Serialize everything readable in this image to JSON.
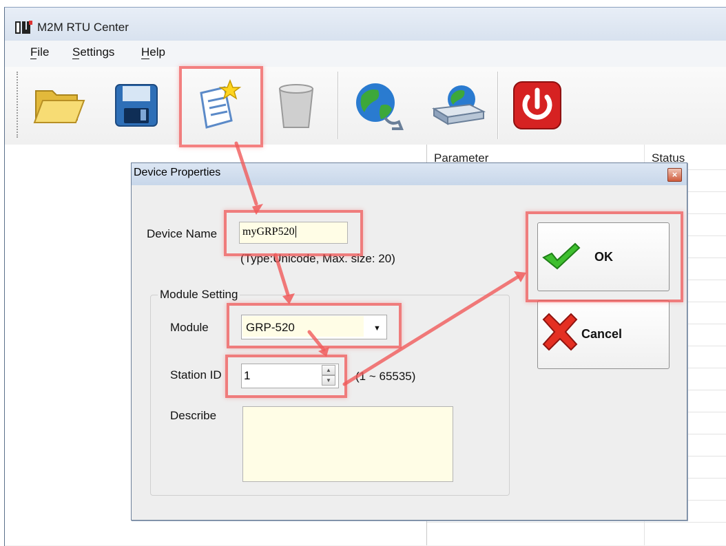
{
  "window": {
    "title": "M2M RTU Center"
  },
  "menu": {
    "items": [
      {
        "label": "File"
      },
      {
        "label": "Settings"
      },
      {
        "label": "Help"
      }
    ]
  },
  "toolbar": {
    "buttons": [
      {
        "icon": "open-folder-icon"
      },
      {
        "icon": "save-disk-icon"
      },
      {
        "icon": "new-document-star-icon"
      },
      {
        "icon": "trash-can-icon"
      },
      {
        "icon": "globe-connect-icon"
      },
      {
        "icon": "globe-server-icon"
      },
      {
        "icon": "power-icon"
      }
    ]
  },
  "grid": {
    "columns": [
      "Parameter",
      "Status"
    ]
  },
  "dialog": {
    "title": "Device Properties",
    "device_name_label": "Device Name",
    "device_name_value": "myGRP520",
    "device_name_hint": "(Type:Unicode, Max. size: 20)",
    "module_setting_title": "Module Setting",
    "module_label": "Module",
    "module_value": "GRP-520",
    "station_id_label": "Station ID",
    "station_id_value": "1",
    "station_id_range": "(1 ~ 65535)",
    "describe_label": "Describe",
    "describe_value": "",
    "ok_label": "OK",
    "cancel_label": "Cancel"
  },
  "colors": {
    "highlight": "#f05050",
    "input_background": "#fffde6",
    "dialog_background": "#eeeeee",
    "titlebar": "#d8e2ef"
  }
}
